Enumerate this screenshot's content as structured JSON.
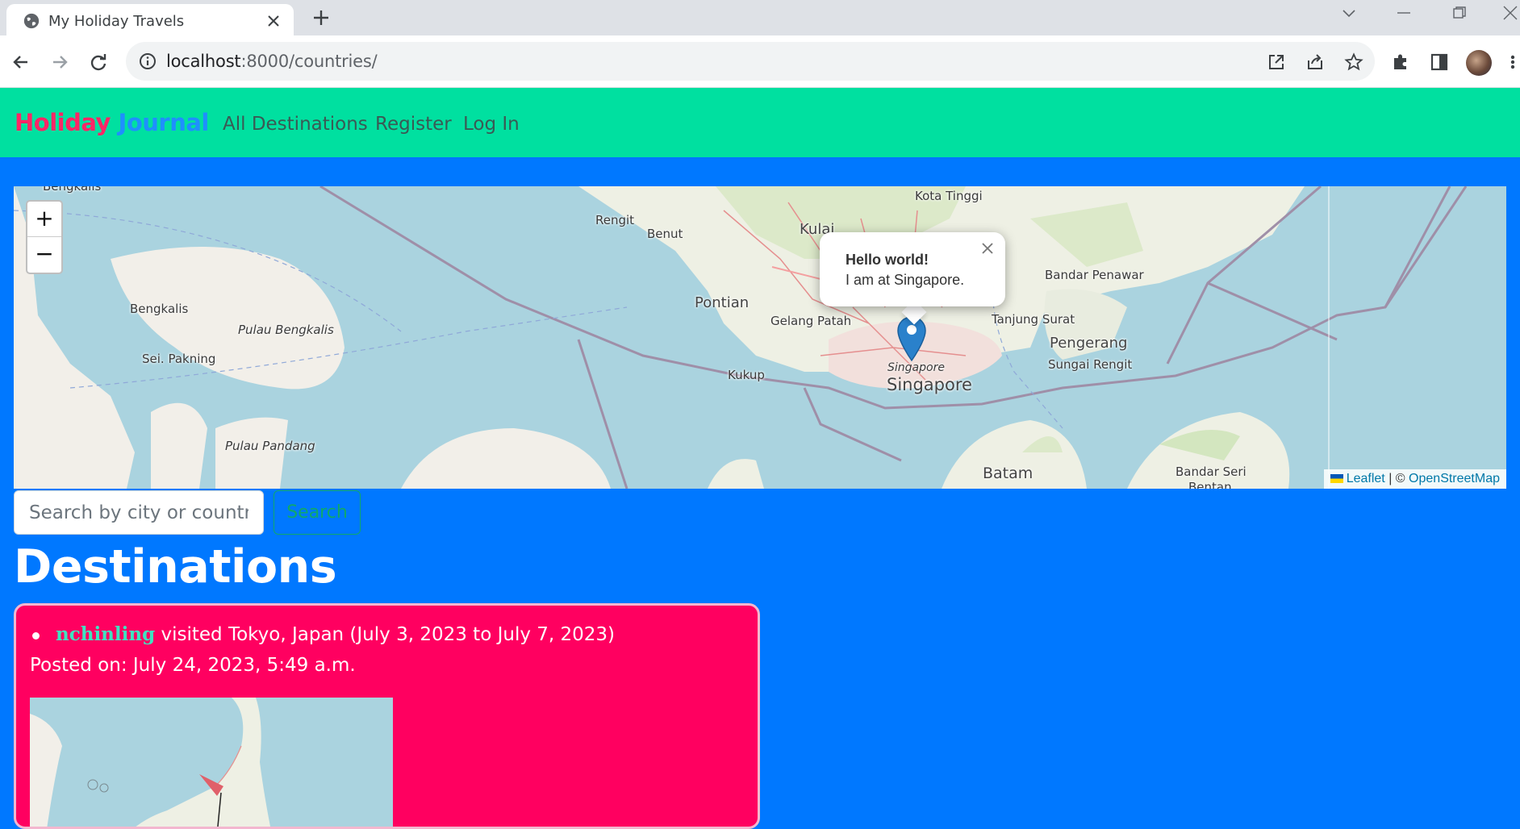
{
  "browser": {
    "tab_title": "My Holiday Travels",
    "url_host": "localhost",
    "url_rest": ":8000/countries/"
  },
  "navbar": {
    "brand_part1": "Holiday",
    "brand_part2": "Journal",
    "links": [
      "All Destinations",
      "Register",
      "Log In"
    ]
  },
  "map": {
    "zoom_in": "+",
    "zoom_out": "−",
    "labels": {
      "bengkalis_top": "Bengkalis",
      "bengkalis": "Bengkalis",
      "pulau_bengkalis": "Pulau Bengkalis",
      "sei_pakning": "Sei. Pakning",
      "pulau_pandang": "Pulau Pandang",
      "rengit": "Rengit",
      "benut": "Benut",
      "pontian": "Pontian",
      "kukup": "Kukup",
      "kulai": "Kulai",
      "kota_tinggi": "Kota Tinggi",
      "gelang_patah": "Gelang Patah",
      "tanjung_surat": "Tanjung Surat",
      "bandar_penawar": "Bandar Penawar",
      "pengerang": "Pengerang",
      "sungai_rengit": "Sungai Rengit",
      "singapore_small": "Singapore",
      "singapore": "Singapore",
      "batam": "Batam",
      "bandar_seri": "Bandar Seri",
      "bentan": "Bentan"
    },
    "popup": {
      "title": "Hello world!",
      "text": "I am at Singapore."
    },
    "attribution": {
      "leaflet": "Leaflet",
      "separator": "| ©",
      "osm": "OpenStreetMap"
    }
  },
  "search": {
    "placeholder": "Search by city or country",
    "button": "Search"
  },
  "destinations": {
    "heading": "Destinations",
    "items": [
      {
        "user": "nchinling",
        "text": "visited Tokyo, Japan (July 3, 2023 to July 7, 2023)",
        "posted": "Posted on: July 24, 2023, 5:49 a.m."
      }
    ]
  },
  "colors": {
    "page_bg": "#0078ff",
    "navbar_bg": "#00e0a0",
    "brand_pink": "#ff2566",
    "brand_blue": "#1f8fff",
    "card_bg": "#ff0060",
    "username": "#3fe3c0",
    "search_outline": "#0fa86a"
  }
}
